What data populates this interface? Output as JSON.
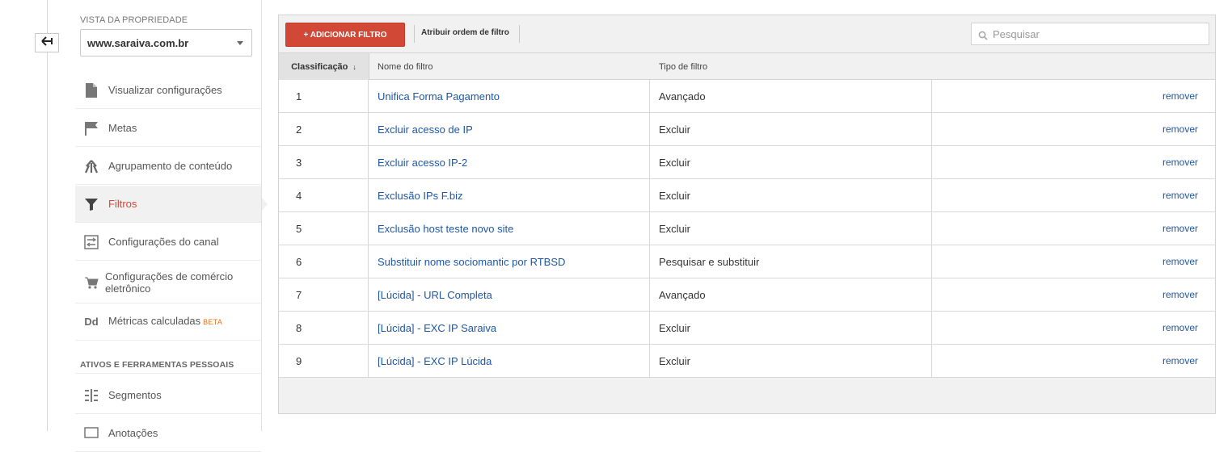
{
  "sidebar": {
    "property_view_label": "VISTA DA PROPRIEDADE",
    "property_view_value": "www.saraiva.com.br",
    "items": [
      {
        "label": "Visualizar configurações",
        "icon": "document-icon"
      },
      {
        "label": "Metas",
        "icon": "flag-icon"
      },
      {
        "label": "Agrupamento de conteúdo",
        "icon": "content-grouping-icon"
      },
      {
        "label": "Filtros",
        "icon": "filter-icon",
        "active": true
      },
      {
        "label": "Configurações do canal",
        "icon": "channel-settings-icon"
      },
      {
        "label": "Configurações de comércio eletrônico",
        "icon": "cart-icon"
      },
      {
        "label": "Métricas calculadas",
        "icon": "dd-icon",
        "badge": "BETA"
      }
    ],
    "personal_section_label": "ATIVOS E FERRAMENTAS PESSOAIS",
    "personal_items": [
      {
        "label": "Segmentos",
        "icon": "segments-icon"
      },
      {
        "label": "Anotações",
        "icon": "annotations-icon"
      }
    ]
  },
  "toolbar": {
    "add_filter_label": "+ ADICIONAR FILTRO",
    "assign_order_label": "Atribuir ordem de filtro",
    "search_placeholder": "Pesquisar"
  },
  "table": {
    "headers": {
      "rank": "Classificação",
      "name": "Nome do filtro",
      "type": "Tipo de filtro"
    },
    "sort_indicator": "↓",
    "remove_label": "remover",
    "rows": [
      {
        "rank": "1",
        "name": "Unifica Forma Pagamento",
        "type": "Avançado"
      },
      {
        "rank": "2",
        "name": "Excluir acesso de IP",
        "type": "Excluir"
      },
      {
        "rank": "3",
        "name": "Excluir acesso IP-2",
        "type": "Excluir"
      },
      {
        "rank": "4",
        "name": "Exclusão IPs F.biz",
        "type": "Excluir"
      },
      {
        "rank": "5",
        "name": "Exclusão host teste novo site",
        "type": "Excluir"
      },
      {
        "rank": "6",
        "name": "Substituir nome sociomantic por RTBSD",
        "type": "Pesquisar e substituir"
      },
      {
        "rank": "7",
        "name": "[Lúcida] - URL Completa",
        "type": "Avançado"
      },
      {
        "rank": "8",
        "name": "[Lúcida] - EXC IP Saraiva",
        "type": "Excluir"
      },
      {
        "rank": "9",
        "name": "[Lúcida] - EXC IP Lúcida",
        "type": "Excluir"
      }
    ]
  },
  "colors": {
    "accent_red": "#d14836",
    "link_blue": "#1f57a5",
    "beta_orange": "#e8711c"
  }
}
